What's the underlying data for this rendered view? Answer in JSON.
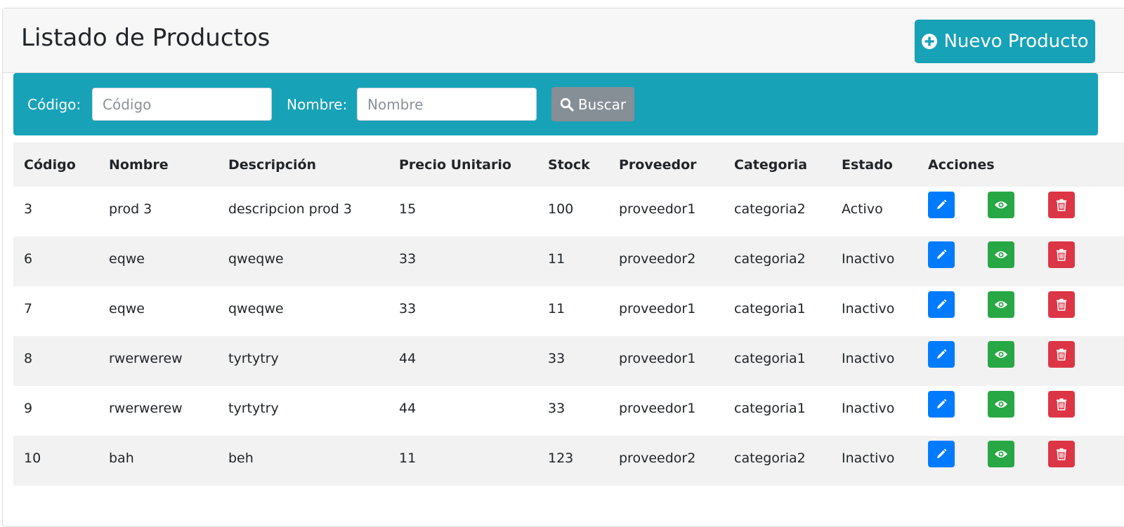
{
  "header": {
    "title": "Listado de Productos",
    "new_button_label": "Nuevo Producto"
  },
  "search": {
    "codigo_label": "Código:",
    "codigo_placeholder": "Código",
    "nombre_label": "Nombre:",
    "nombre_placeholder": "Nombre",
    "button_label": "Buscar"
  },
  "table": {
    "columns": [
      "Código",
      "Nombre",
      "Descripción",
      "Precio Unitario",
      "Stock",
      "Proveedor",
      "Categoria",
      "Estado",
      "Acciones"
    ],
    "rows": [
      {
        "codigo": "3",
        "nombre": "prod 3",
        "descripcion": "descripcion prod 3",
        "precio": "15",
        "stock": "100",
        "proveedor": "proveedor1",
        "categoria": "categoria2",
        "estado": "Activo"
      },
      {
        "codigo": "6",
        "nombre": "eqwe",
        "descripcion": "qweqwe",
        "precio": "33",
        "stock": "11",
        "proveedor": "proveedor2",
        "categoria": "categoria2",
        "estado": "Inactivo"
      },
      {
        "codigo": "7",
        "nombre": "eqwe",
        "descripcion": "qweqwe",
        "precio": "33",
        "stock": "11",
        "proveedor": "proveedor1",
        "categoria": "categoria1",
        "estado": "Inactivo"
      },
      {
        "codigo": "8",
        "nombre": "rwerwerew",
        "descripcion": "tyrtytry",
        "precio": "44",
        "stock": "33",
        "proveedor": "proveedor1",
        "categoria": "categoria1",
        "estado": "Inactivo"
      },
      {
        "codigo": "9",
        "nombre": "rwerwerew",
        "descripcion": "tyrtytry",
        "precio": "44",
        "stock": "33",
        "proveedor": "proveedor1",
        "categoria": "categoria1",
        "estado": "Inactivo"
      },
      {
        "codigo": "10",
        "nombre": "bah",
        "descripcion": "beh",
        "precio": "11",
        "stock": "123",
        "proveedor": "proveedor2",
        "categoria": "categoria2",
        "estado": "Inactivo"
      }
    ],
    "actions": [
      {
        "name": "edit",
        "icon": "pencil-icon",
        "color": "#007bff"
      },
      {
        "name": "view",
        "icon": "eye-icon",
        "color": "#28a745"
      },
      {
        "name": "delete",
        "icon": "trash-icon",
        "color": "#dc3545"
      }
    ]
  },
  "colors": {
    "accent": "#17a2b8",
    "search_button": "#868e96"
  }
}
